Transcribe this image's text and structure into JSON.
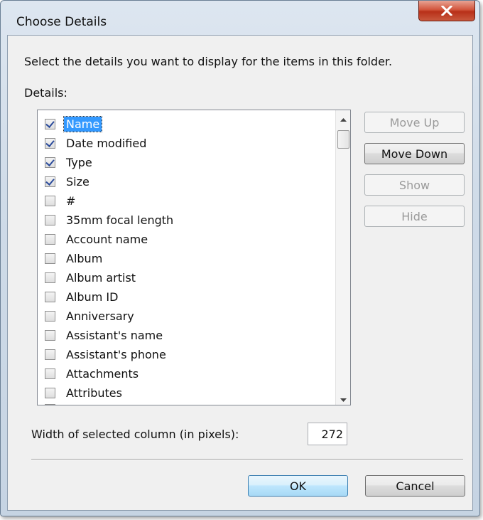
{
  "window": {
    "title": "Choose Details",
    "close_icon": "close-icon"
  },
  "instruction": "Select the details you want to display for the items in this folder.",
  "details_label": "Details:",
  "details_list": [
    {
      "label": "Name",
      "checked": true,
      "selected": true
    },
    {
      "label": "Date modified",
      "checked": true,
      "selected": false
    },
    {
      "label": "Type",
      "checked": true,
      "selected": false
    },
    {
      "label": "Size",
      "checked": true,
      "selected": false
    },
    {
      "label": "#",
      "checked": false,
      "selected": false
    },
    {
      "label": "35mm focal length",
      "checked": false,
      "selected": false
    },
    {
      "label": "Account name",
      "checked": false,
      "selected": false
    },
    {
      "label": "Album",
      "checked": false,
      "selected": false
    },
    {
      "label": "Album artist",
      "checked": false,
      "selected": false
    },
    {
      "label": "Album ID",
      "checked": false,
      "selected": false
    },
    {
      "label": "Anniversary",
      "checked": false,
      "selected": false
    },
    {
      "label": "Assistant's name",
      "checked": false,
      "selected": false
    },
    {
      "label": "Assistant's phone",
      "checked": false,
      "selected": false
    },
    {
      "label": "Attachments",
      "checked": false,
      "selected": false
    },
    {
      "label": "Attributes",
      "checked": false,
      "selected": false
    }
  ],
  "side_buttons": {
    "move_up": "Move Up",
    "move_down": "Move Down",
    "show": "Show",
    "hide": "Hide"
  },
  "width_label": "Width of selected column (in pixels):",
  "width_value": "272",
  "footer_buttons": {
    "ok": "OK",
    "cancel": "Cancel"
  },
  "colors": {
    "selection": "#3399ff",
    "close_button": "#c9452b"
  }
}
